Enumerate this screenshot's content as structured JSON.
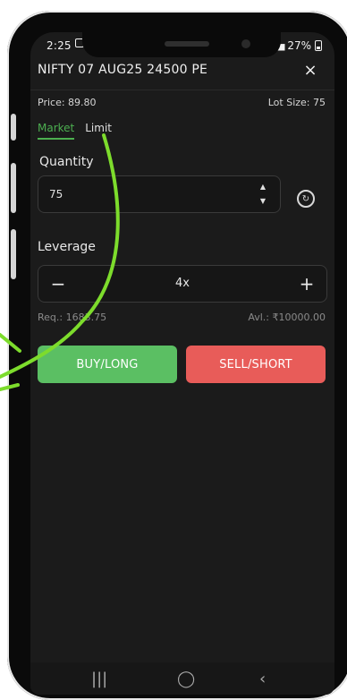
{
  "status_bar": {
    "time": "2:25",
    "battery": "27%"
  },
  "header": {
    "title": "NIFTY 07 AUG25 24500 PE",
    "close_symbol": "×"
  },
  "order_info": {
    "price": "Price: 89.80",
    "lot_size": "Lot Size: 75"
  },
  "tabs": [
    {
      "label": "Market",
      "active": true
    },
    {
      "label": "Limit",
      "active": false
    }
  ],
  "quantity": {
    "label": "Quantity",
    "value": "75"
  },
  "leverage": {
    "label": "Leverage",
    "value": "4x",
    "minus": "−",
    "plus": "+"
  },
  "requirements": {
    "required": "Req.: 1683.75",
    "available": "Avl.: ₹10000.00"
  },
  "actions": {
    "buy_label": "BUY/LONG",
    "sell_label": "SELL/SHORT"
  },
  "colors": {
    "accent_green": "#5bbf63",
    "accent_red": "#e85c59",
    "arrow_green": "#7ddc2c"
  },
  "icons": {
    "close": "close-icon",
    "refresh": "refresh-icon",
    "stepper": "stepper-icon",
    "recent_apps": "recent-apps-icon",
    "home": "home-icon",
    "back": "back-icon"
  }
}
